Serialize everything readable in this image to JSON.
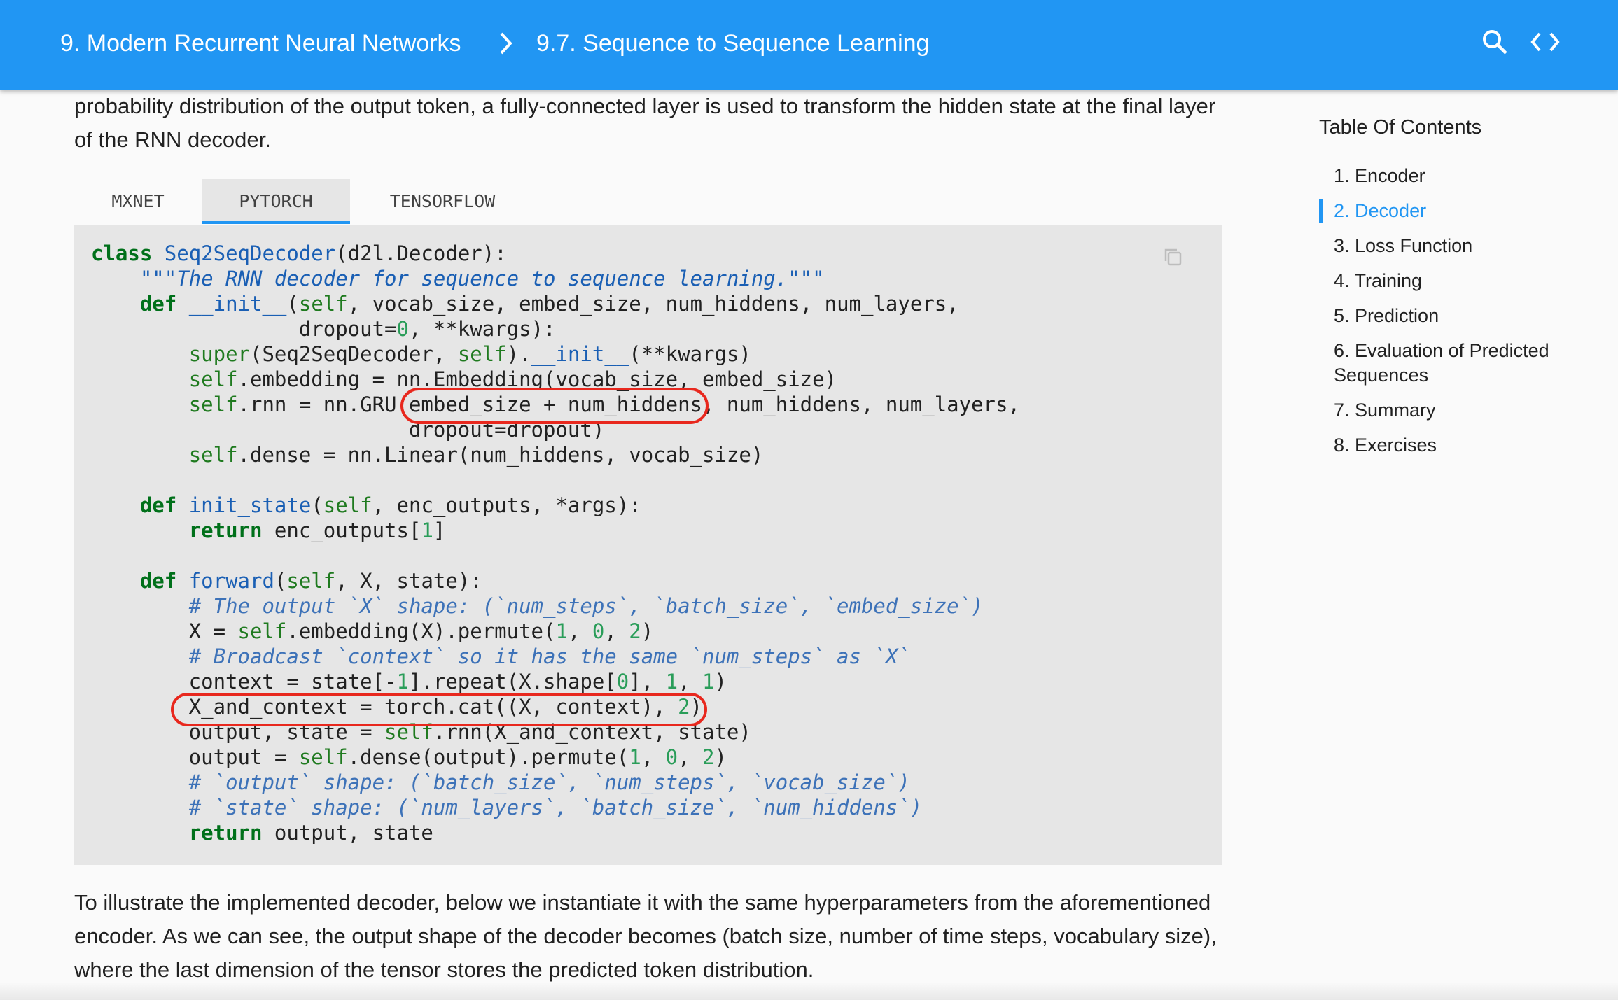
{
  "header": {
    "breadcrumb_parent": "9. Modern Recurrent Neural Networks",
    "breadcrumb_separator": ">",
    "breadcrumb_current": "9.7. Sequence to Sequence Learning",
    "icons": [
      "search-icon",
      "code-icon"
    ],
    "bg_color": "#2196f3"
  },
  "main": {
    "intro_text": "probability distribution of the output token, a fully-connected layer is used to transform the hidden state at the final layer of the RNN decoder.",
    "tabs": [
      {
        "label": "MXNET",
        "active": false
      },
      {
        "label": "PYTORCH",
        "active": true
      },
      {
        "label": "TENSORFLOW",
        "active": false
      }
    ],
    "code_lines": [
      "class Seq2SeqDecoder(d2l.Decoder):",
      "    \"\"\"The RNN decoder for sequence to sequence learning.\"\"\"",
      "    def __init__(self, vocab_size, embed_size, num_hiddens, num_layers,",
      "                 dropout=0, **kwargs):",
      "        super(Seq2SeqDecoder, self).__init__(**kwargs)",
      "        self.embedding = nn.Embedding(vocab_size, embed_size)",
      "        self.rnn = nn.GRU(embed_size + num_hiddens, num_hiddens, num_layers,",
      "                          dropout=dropout)",
      "        self.dense = nn.Linear(num_hiddens, vocab_size)",
      "",
      "    def init_state(self, enc_outputs, *args):",
      "        return enc_outputs[1]",
      "",
      "    def forward(self, X, state):",
      "        # The output `X` shape: (`num_steps`, `batch_size`, `embed_size`)",
      "        X = self.embedding(X).permute(1, 0, 2)",
      "        # Broadcast `context` so it has the same `num_steps` as `X`",
      "        context = state[-1].repeat(X.shape[0], 1, 1)",
      "        X_and_context = torch.cat((X, context), 2)",
      "        output, state = self.rnn(X_and_context, state)",
      "        output = self.dense(output).permute(1, 0, 2)",
      "        # `output` shape: (`batch_size`, `num_steps`, `vocab_size`)",
      "        # `state` shape: (`num_layers`, `batch_size`, `num_hiddens`)",
      "        return output, state"
    ],
    "highlighted_snippets": [
      "embed_size + num_hiddens",
      "X_and_context = torch.cat((X, context), 2)"
    ],
    "annotation_color": "#e8281e",
    "outro_text": "To illustrate the implemented decoder, below we instantiate it with the same hyperparameters from the aforementioned encoder. As we can see, the output shape of the decoder becomes (batch size, number of time steps, vocabulary size), where the last dimension of the tensor stores the predicted token distribution."
  },
  "toc": {
    "title": "Table Of Contents",
    "items": [
      {
        "label": "1. Encoder",
        "active": false
      },
      {
        "label": "2. Decoder",
        "active": true
      },
      {
        "label": "3. Loss Function",
        "active": false
      },
      {
        "label": "4. Training",
        "active": false
      },
      {
        "label": "5. Prediction",
        "active": false
      },
      {
        "label": "6. Evaluation of Predicted Sequences",
        "active": false
      },
      {
        "label": "7. Summary",
        "active": false
      },
      {
        "label": "8. Exercises",
        "active": false
      }
    ]
  }
}
